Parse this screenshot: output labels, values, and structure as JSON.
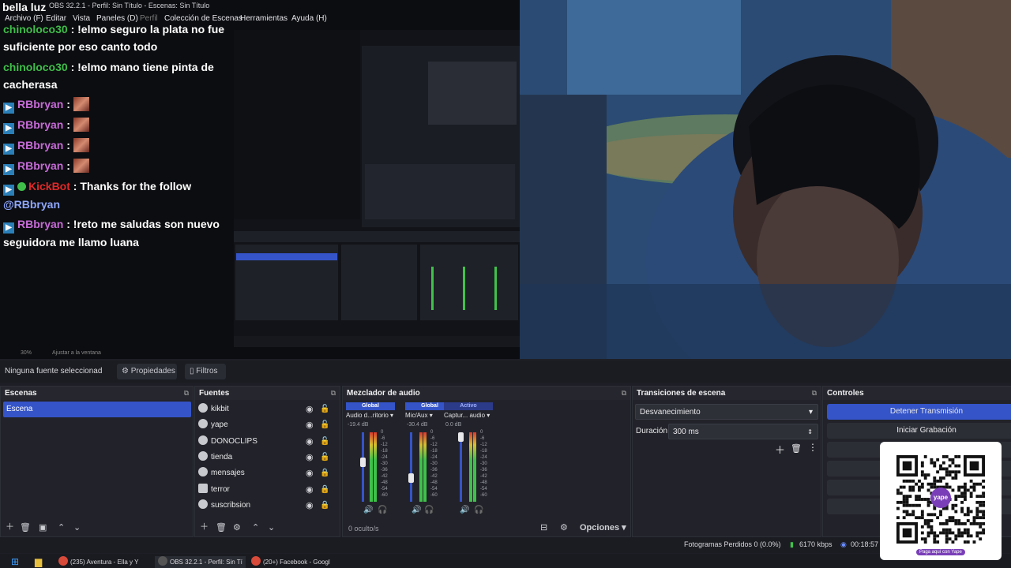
{
  "window": {
    "title": "OBS 32.2.1 - Perfil: Sin Título - Escenas: Sin Título",
    "streamer_overlay": "bella luz"
  },
  "menu": [
    "Archivo (F)",
    "Editar",
    "Vista",
    "Paneles (D)",
    "Perfil",
    "Colección de Escenas",
    "Herramientas",
    "Ayuda (H)"
  ],
  "chat": {
    "messages": [
      {
        "user": "chinoloco30",
        "color": "#3fbf4a",
        "text": ": !elmo seguro la plata no fue suficiente por eso canto todo"
      },
      {
        "user": "chinoloco30",
        "color": "#3fbf4a",
        "text": ": !elmo mano tiene pinta de cacherasa"
      },
      {
        "user": "RBbryan",
        "color": "#c76bd8",
        "text": ":",
        "emote": true
      },
      {
        "user": "RBbryan",
        "color": "#c76bd8",
        "text": ":",
        "emote": true
      },
      {
        "user": "RBbryan",
        "color": "#c76bd8",
        "text": ":",
        "emote": true
      },
      {
        "user": "RBbryan",
        "color": "#c76bd8",
        "text": ":",
        "emote": true
      },
      {
        "user": "KickBot",
        "color": "#e02828",
        "text": ": Thanks for the follow",
        "mention": "@RBbryan"
      },
      {
        "user": "RBbryan",
        "color": "#c76bd8",
        "text": ": !reto me saludas son nuevo seguidora me llamo luana"
      }
    ]
  },
  "zoom": {
    "level": "30%",
    "fit": "Ajustar a la ventana"
  },
  "properties_bar": {
    "selection": "Ninguna fuente seleccionad",
    "properties": "Propiedades",
    "filters": "Filtros"
  },
  "scenes": {
    "title": "Escenas",
    "items": [
      "Escena"
    ]
  },
  "sources": {
    "title": "Fuentes",
    "items": [
      {
        "name": "kikbit",
        "locked": false
      },
      {
        "name": "yape",
        "locked": false
      },
      {
        "name": "DONOCLIPS",
        "locked": false
      },
      {
        "name": "tienda",
        "locked": false
      },
      {
        "name": "mensajes",
        "locked": true
      },
      {
        "name": "terror",
        "locked": true
      },
      {
        "name": "suscribsion",
        "locked": true
      }
    ]
  },
  "mixer": {
    "title": "Mezclador de audio",
    "channels": [
      {
        "scope": "Global",
        "name": "Audio d...ritorio",
        "db": "-19.4 dB",
        "level": 0.55,
        "fader": 0.6
      },
      {
        "scope": "Global",
        "name": "Mic/Aux",
        "db": "-30.4 dB",
        "level": 0.45,
        "fader": 0.35
      },
      {
        "scope": "Activo",
        "name": "Captur... audio",
        "db": "0.0 dB",
        "level": 0.7,
        "fader": 1.0
      }
    ],
    "ticks": [
      "0",
      "-6",
      "-12",
      "-18",
      "-24",
      "-30",
      "-36",
      "-42",
      "-48",
      "-54",
      "-60"
    ],
    "hidden": "0 oculto/s",
    "options": "Opciones"
  },
  "transitions": {
    "title": "Transiciones de escena",
    "type": "Desvanecimiento",
    "duration_label": "Duración",
    "duration": "300 ms"
  },
  "controls": {
    "title": "Controles",
    "stop_stream": "Detener Transmisión",
    "start_record": "Iniciar Grabación"
  },
  "status": {
    "dropped": "Fotogramas Perdidos 0 (0.0%)",
    "bitrate": "6170 kbps",
    "time": "00:18:57"
  },
  "taskbar": {
    "items": [
      "(235) Aventura - Ella y Y",
      "OBS 32.2.1 - Perfil: Sin Tí",
      "(20+) Facebook - Googl"
    ]
  },
  "qr": {
    "brand": "yape",
    "caption": "Paga aquí con Yape"
  },
  "colors": {
    "accent": "#3554c8",
    "panel": "#22232a",
    "bg": "#1e1f26"
  }
}
